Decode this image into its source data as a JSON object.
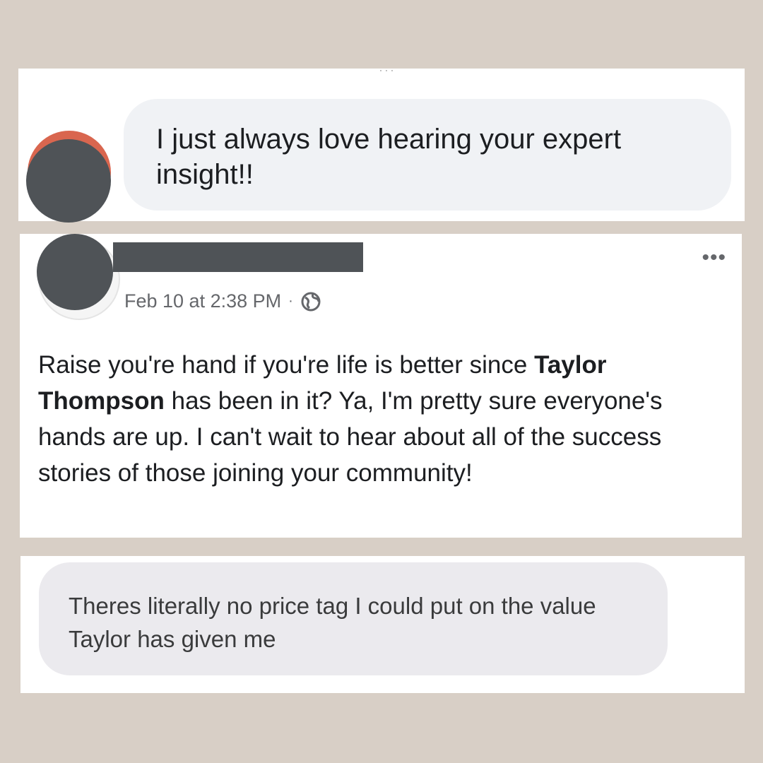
{
  "comment_top": {
    "cutoff_text": "···",
    "text": "I just always love hearing your expert insight!!"
  },
  "post": {
    "author_redacted": true,
    "timestamp": "Feb 10 at 2:38 PM",
    "separator": "·",
    "privacy_icon": "globe-icon",
    "more_label": "•••",
    "body_part1": "Raise you're hand if you're life is better since ",
    "body_bold": "Taylor Thompson",
    "body_part2": " has been in it? Ya, I'm pretty sure everyone's hands are up. I can't wait to hear about all of the success stories of those joining your community!"
  },
  "comment_bottom": {
    "text": "Theres literally no price tag I could put on the value Taylor has given me"
  },
  "colors": {
    "background": "#d8cfc6",
    "bubble": "#f0f2f5",
    "redaction": "#4f5357",
    "avatar_accent": "#d9664f",
    "meta_text": "#65676b"
  }
}
